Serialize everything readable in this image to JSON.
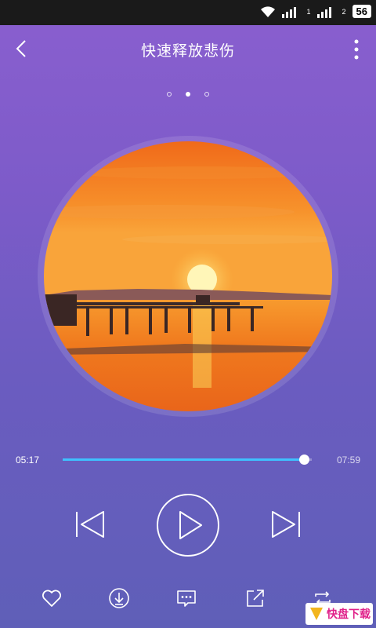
{
  "status_bar": {
    "sim1_label": "1",
    "sim2_label": "2",
    "battery": "56"
  },
  "header": {
    "title": "快速释放悲伤"
  },
  "pager": {
    "count": 3,
    "active_index": 1
  },
  "player": {
    "current_time": "05:17",
    "total_time": "07:59",
    "progress_fraction": 0.97
  },
  "colors": {
    "accent": "#3fc0ff",
    "background_top": "#8a5fcf",
    "background_bottom": "#5f5fb8"
  },
  "icons": {
    "prev": "skip-previous-icon",
    "play": "play-icon",
    "next": "skip-next-icon",
    "favorite": "heart-icon",
    "download": "download-icon",
    "comment": "comment-icon",
    "share": "share-icon",
    "repeat": "repeat-icon"
  },
  "watermark": {
    "text": "快盘下载"
  }
}
